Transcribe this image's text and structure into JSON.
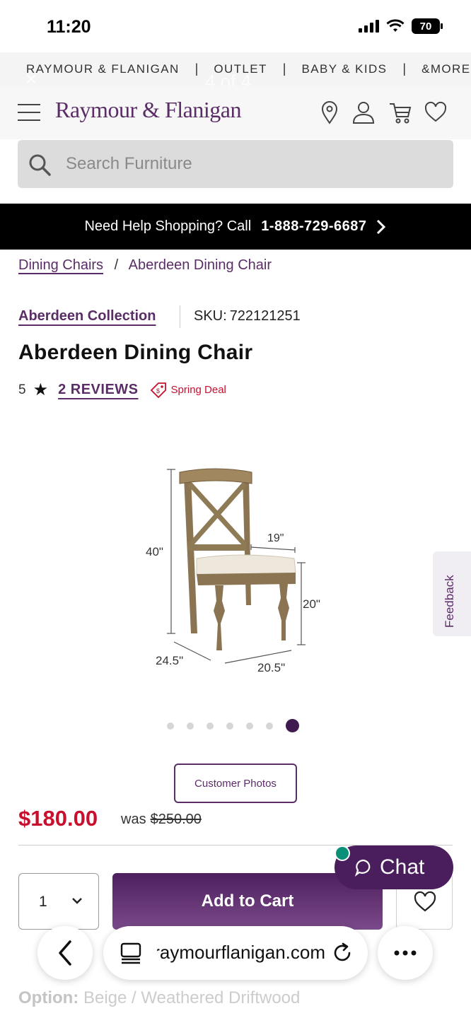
{
  "status_bar": {
    "time": "11:20",
    "battery": "70"
  },
  "top_nav": {
    "items": [
      "RAYMOUR & FLANIGAN",
      "OUTLET",
      "BABY & KIDS",
      "&MORE"
    ],
    "separator": "|"
  },
  "overlay": {
    "close": "×",
    "count": "4 of 4"
  },
  "header": {
    "logo": "Raymour & Flanigan"
  },
  "search": {
    "placeholder": "Search Furniture"
  },
  "help_banner": {
    "text": "Need Help Shopping? Call",
    "phone": "1-888-729-6687"
  },
  "breadcrumb": {
    "parent": "Dining Chairs",
    "separator": "/",
    "current": "Aberdeen Dining Chair"
  },
  "product": {
    "collection": "Aberdeen Collection",
    "sku_label": "SKU:",
    "sku": "722121251",
    "title": "Aberdeen Dining Chair",
    "rating": "5",
    "reviews": "2 REVIEWS",
    "deal": "Spring Deal",
    "dimensions": {
      "height": "40\"",
      "seat_depth": "19\"",
      "seat_height": "20\"",
      "depth": "24.5\"",
      "width": "20.5\""
    },
    "carousel": {
      "count": 7,
      "active": 7
    },
    "customer_photos": "Customer Photos",
    "price": "$180.00",
    "was_label": "was",
    "was_price": "$250.00",
    "quantity": "1",
    "add_to_cart": "Add to Cart",
    "option_label": "Option:",
    "option_value": "Beige / Weathered Driftwood"
  },
  "feedback": "Feedback",
  "chat": "Chat",
  "browser": {
    "url": "raymourflanigan.com"
  },
  "colors": {
    "brand_purple": "#5a2d67",
    "sale_red": "#c8102e",
    "chat_green": "#0a8f78"
  }
}
